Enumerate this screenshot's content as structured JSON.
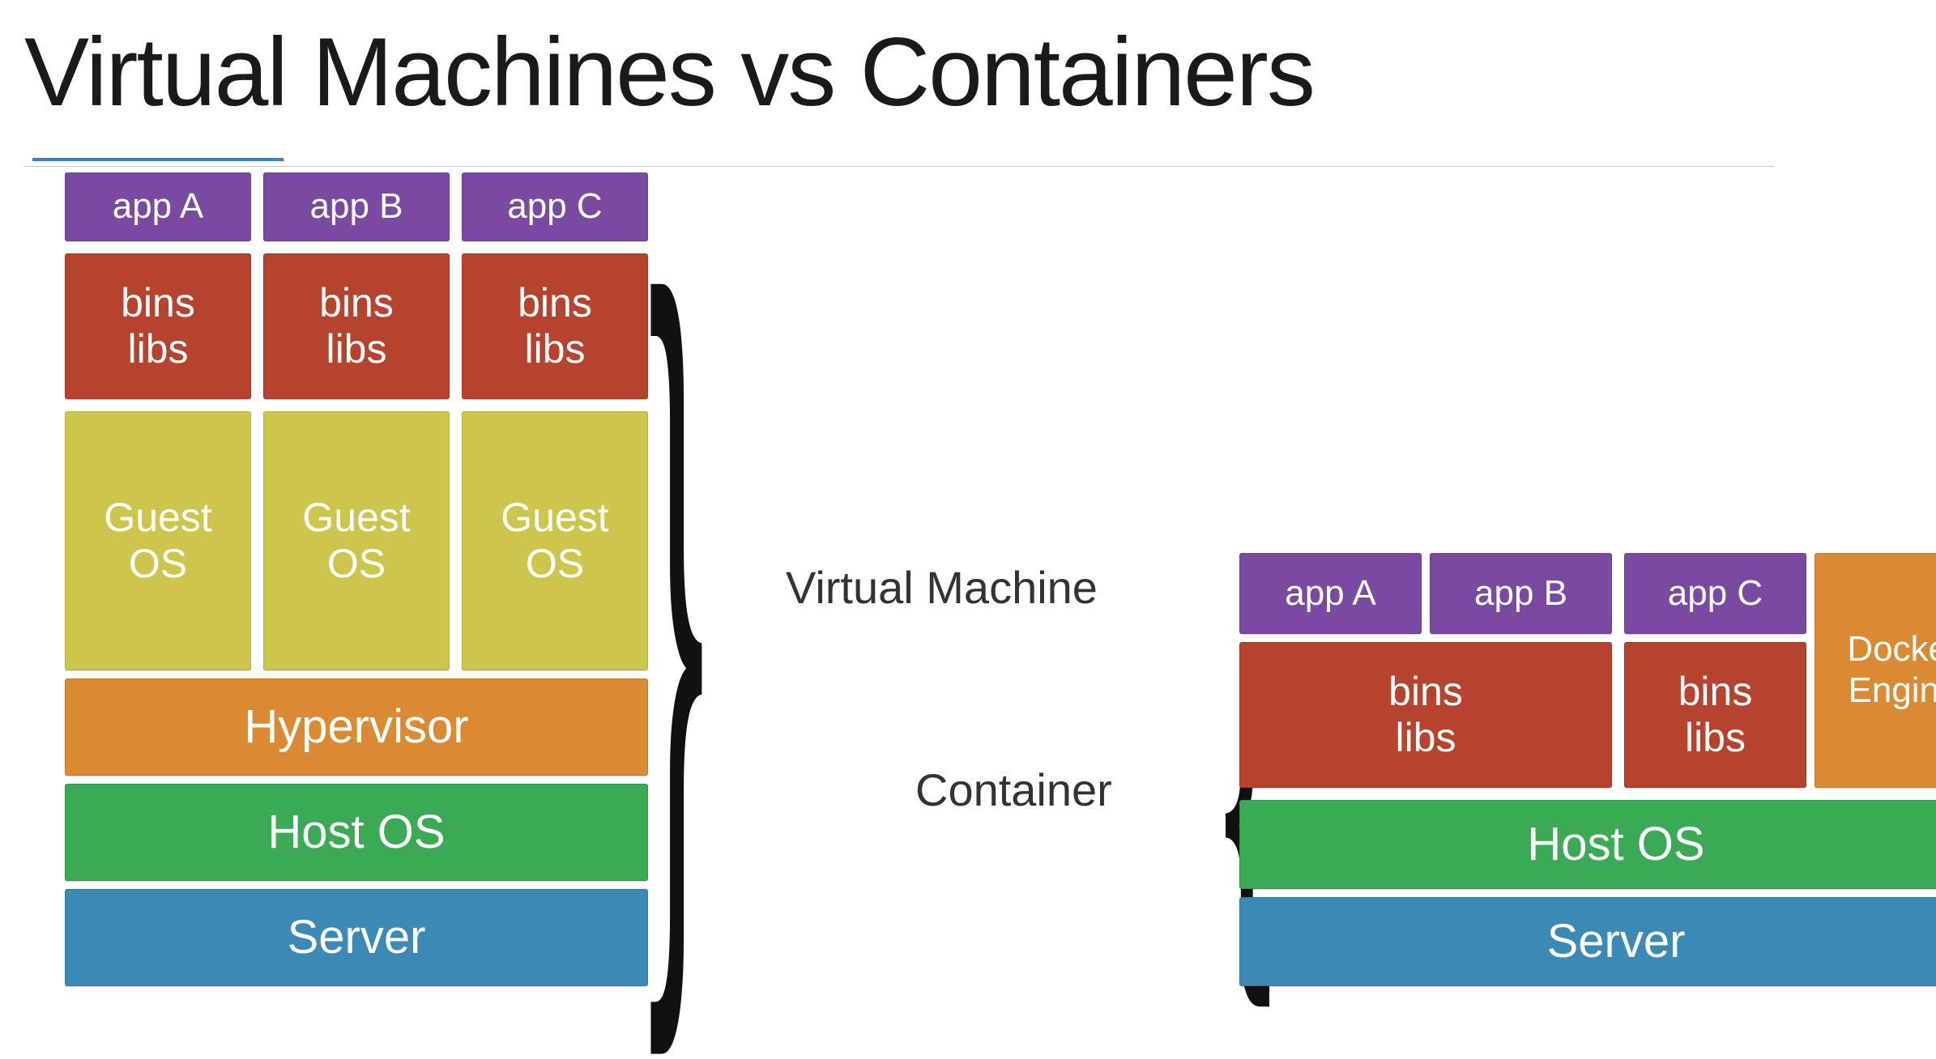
{
  "title": "Virtual Machines vs Containers",
  "labels": {
    "virtual_machine": "Virtual Machine",
    "container": "Container"
  },
  "colors": {
    "app": "#7a4aa3",
    "bins_libs": "#b6432d",
    "guest_os": "#cdc64d",
    "hypervisor_docker": "#d98a33",
    "host_os": "#3aab54",
    "server": "#3b8ab5"
  },
  "vm_stack": {
    "server": "Server",
    "host_os": "Host OS",
    "hypervisor": "Hypervisor",
    "columns": [
      {
        "app": "app A",
        "bins": "bins\nlibs",
        "guest": "Guest\nOS"
      },
      {
        "app": "app B",
        "bins": "bins\nlibs",
        "guest": "Guest\nOS"
      },
      {
        "app": "app C",
        "bins": "bins\nlibs",
        "guest": "Guest\nOS"
      }
    ]
  },
  "container_stack": {
    "server": "Server",
    "host_os": "Host OS",
    "docker_engine": "Docker\nEngine",
    "bins_left": "bins\nlibs",
    "bins_right": "bins\nlibs",
    "apps": [
      "app A",
      "app B",
      "app C"
    ]
  }
}
